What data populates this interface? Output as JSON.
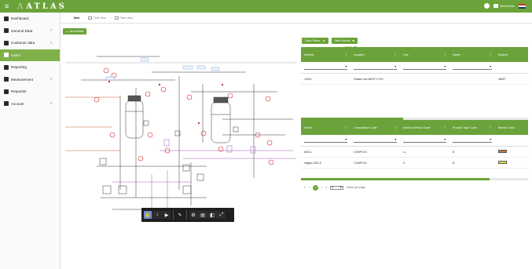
{
  "app": {
    "logo": "ATLAS"
  },
  "topbar": {
    "user_label": "Beheerder"
  },
  "sidebar": {
    "items": [
      {
        "label": "Dashboard",
        "icon": "dashboard-icon",
        "chevron": false,
        "active": false
      },
      {
        "label": "General Data",
        "icon": "table-icon",
        "chevron": true,
        "active": false
      },
      {
        "label": "Customer data",
        "icon": "tools-icon",
        "chevron": true,
        "active": false
      },
      {
        "label": "Users",
        "icon": "users-icon",
        "chevron": false,
        "active": true
      },
      {
        "label": "Reporting",
        "icon": "chart-icon",
        "chevron": false,
        "active": false
      },
      {
        "label": "Measurement",
        "icon": "measurement-icon",
        "chevron": true,
        "active": false
      },
      {
        "label": "Requests",
        "icon": "requests-icon",
        "chevron": false,
        "active": false
      },
      {
        "label": "Account",
        "icon": "account-icon",
        "chevron": true,
        "active": false
      }
    ]
  },
  "tabs": [
    {
      "label": "Item",
      "active": true
    },
    {
      "label": "Grid View",
      "active": false
    },
    {
      "label": "Tree View",
      "active": false
    }
  ],
  "new_button": {
    "label": "New Media"
  },
  "filters": {
    "clear_label": "Clear Filters",
    "new_source_label": "New Source"
  },
  "table1": {
    "columns": [
      "Number",
      "Location",
      "Line",
      "Name",
      "System"
    ],
    "rows": [
      [
        "13416",
        "Zinkant van 4801F t+C4+",
        "",
        "",
        "4801F"
      ]
    ],
    "pager": {
      "page": "1",
      "page_size": "5",
      "per_page_label": "items per page"
    }
  },
  "table2": {
    "columns": [
      "Name",
      "Composition Code",
      "Medium Device Code",
      "Product Type Code",
      "Stream Color"
    ],
    "rows": [
      {
        "cells": [
          "6502-J",
          "COMPO23",
          "LL",
          "B"
        ],
        "color": "#c67a3c"
      },
      {
        "cells": [
          "cff/gas-4301-E",
          "COMPO24",
          "G",
          "B"
        ],
        "color": "#e8e04a"
      }
    ],
    "pager": {
      "page": "1",
      "page_size": "5",
      "per_page_label": "items per page"
    }
  },
  "colors": {
    "brand": "#6ba33a",
    "active_nav": "#7fb04a",
    "pid_red": "#d63030",
    "pid_purple": "#9b59b6"
  }
}
